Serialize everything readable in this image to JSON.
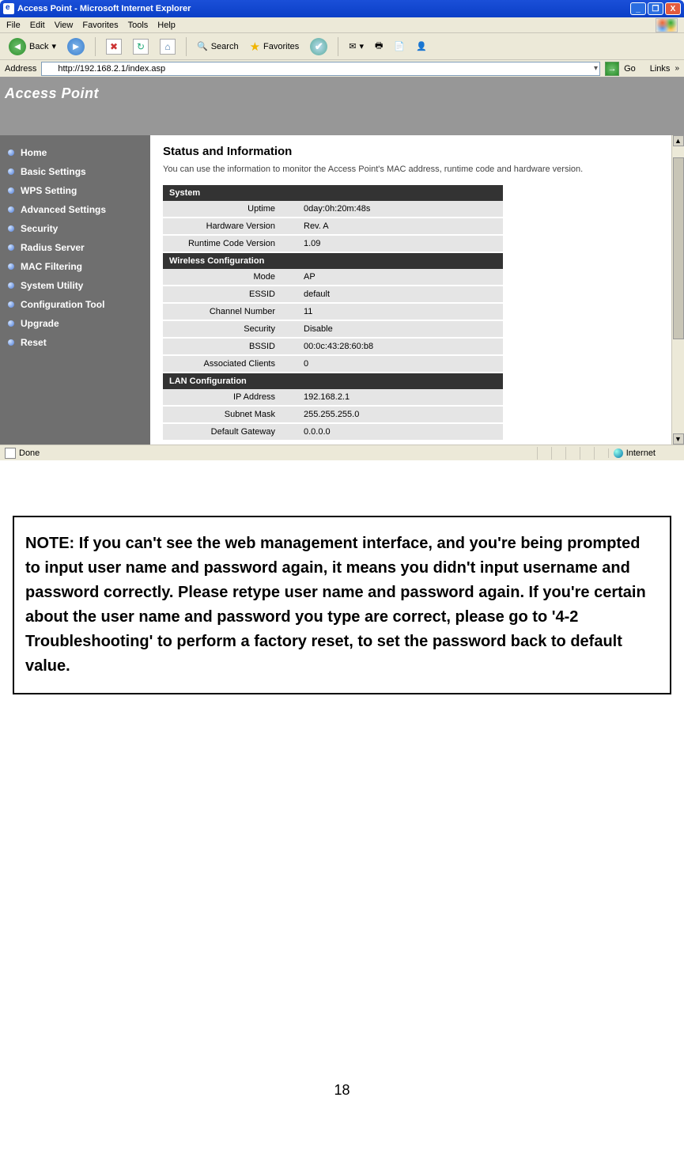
{
  "titlebar": {
    "title": "Access Point - Microsoft Internet Explorer"
  },
  "win_buttons": {
    "min": "_",
    "max": "❐",
    "close": "X"
  },
  "menubar": [
    "File",
    "Edit",
    "View",
    "Favorites",
    "Tools",
    "Help"
  ],
  "toolbar": {
    "back": "Back",
    "search": "Search",
    "favorites": "Favorites"
  },
  "addressbar": {
    "label": "Address",
    "url": "http://192.168.2.1/index.asp",
    "go": "Go",
    "links": "Links"
  },
  "banner": "Access Point",
  "sidebar_items": [
    "Home",
    "Basic Settings",
    "WPS Setting",
    "Advanced Settings",
    "Security",
    "Radius Server",
    "MAC Filtering",
    "System Utility",
    "Configuration Tool",
    "Upgrade",
    "Reset"
  ],
  "content": {
    "heading": "Status and Information",
    "desc": "You can use the information to monitor the Access Point's MAC address, runtime code and hardware version.",
    "sections": [
      {
        "title": "System",
        "rows": [
          [
            "Uptime",
            "0day:0h:20m:48s"
          ],
          [
            "Hardware Version",
            "Rev. A"
          ],
          [
            "Runtime Code Version",
            "1.09"
          ]
        ]
      },
      {
        "title": "Wireless Configuration",
        "rows": [
          [
            "Mode",
            "AP"
          ],
          [
            "ESSID",
            "default"
          ],
          [
            "Channel Number",
            "11"
          ],
          [
            "Security",
            "Disable"
          ],
          [
            "BSSID",
            "00:0c:43:28:60:b8"
          ],
          [
            "Associated Clients",
            "0"
          ]
        ]
      },
      {
        "title": "LAN Configuration",
        "rows": [
          [
            "IP Address",
            "192.168.2.1"
          ],
          [
            "Subnet Mask",
            "255.255.255.0"
          ],
          [
            "Default Gateway",
            "0.0.0.0"
          ]
        ]
      }
    ]
  },
  "statusbar": {
    "done": "Done",
    "zone": "Internet"
  },
  "note": "NOTE: If you can't see the web management interface, and you're being prompted to input user name and password again, it means you didn't input username and password correctly. Please retype user name and password again. If you're certain about the user name and password you type are correct, please go to '4-2 Troubleshooting' to perform a factory reset, to set the password back to default value.",
  "page_number": "18"
}
